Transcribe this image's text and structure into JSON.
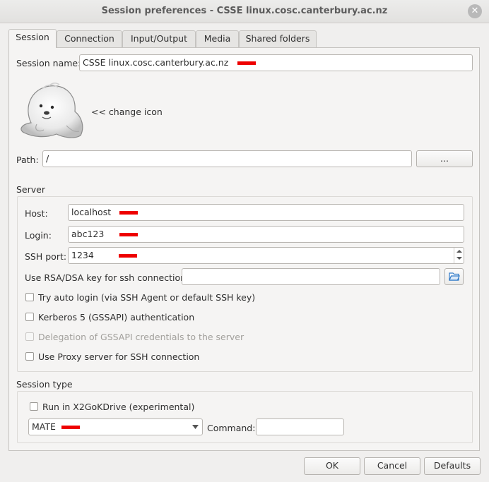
{
  "window": {
    "title": "Session preferences - CSSE linux.cosc.canterbury.ac.nz",
    "close_glyph": "✕"
  },
  "tabs": [
    {
      "label": "Session",
      "mnemonic": "S"
    },
    {
      "label": "Connection",
      "mnemonic": "C"
    },
    {
      "label": "Input/Output",
      "mnemonic": "I"
    },
    {
      "label": "Media",
      "mnemonic": "M"
    },
    {
      "label": "Shared folders",
      "mnemonic": "S"
    }
  ],
  "session": {
    "name_label": "Session name:",
    "name_value": "CSSE linux.cosc.canterbury.ac.nz",
    "change_icon_label": "<< change icon",
    "path_label": "Path:",
    "path_value": "/",
    "browse_label": "..."
  },
  "server": {
    "group_title": "Server",
    "host_label": "Host:",
    "host_value": "localhost",
    "login_label": "Login:",
    "login_value": "abc123",
    "port_label": "SSH port:",
    "port_value": "1234",
    "rsa_label": "Use RSA/DSA key for ssh connection:",
    "rsa_value": "",
    "checkboxes": [
      {
        "label": "Try auto login (via SSH Agent or default SSH key)",
        "checked": false,
        "enabled": true
      },
      {
        "label": "Kerberos 5 (GSSAPI) authentication",
        "checked": false,
        "enabled": true
      },
      {
        "label": "Delegation of GSSAPI credentials to the server",
        "checked": false,
        "enabled": false
      },
      {
        "label": "Use Proxy server for SSH connection",
        "checked": false,
        "enabled": true
      }
    ]
  },
  "session_type": {
    "group_title": "Session type",
    "x2godrive_label": "Run in X2GoKDrive (experimental)",
    "x2godrive_checked": false,
    "type_value": "MATE",
    "command_label": "Command:",
    "command_value": ""
  },
  "footer": {
    "ok_label": "OK",
    "cancel_label": "Cancel",
    "defaults_label": "Defaults"
  },
  "colors": {
    "redaction": "#ee0000",
    "folder_icon": "#2f79c7"
  }
}
